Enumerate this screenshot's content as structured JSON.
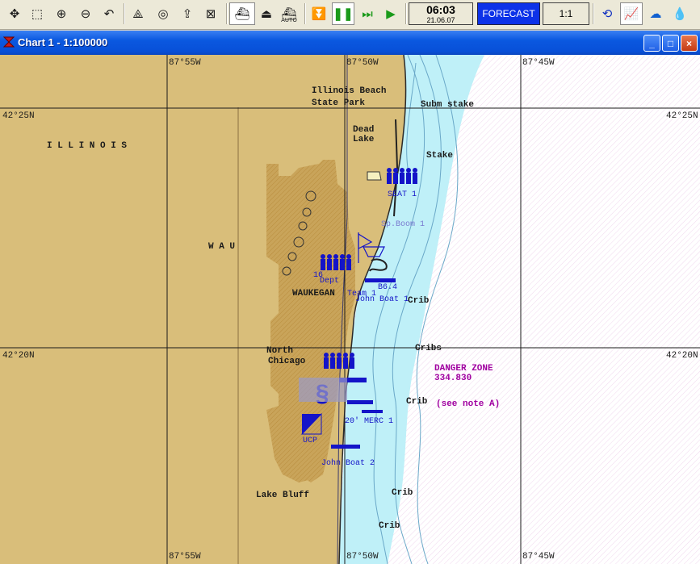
{
  "toolbar": {
    "buttons": [
      "pan-icon",
      "select-icon",
      "zoom-in-icon",
      "zoom-out-icon",
      "undo-icon",
      "route-icon",
      "target-icon",
      "export-icon",
      "import-icon",
      "ship-icon",
      "boat-icon",
      "auto-ship-icon",
      "stop-icon",
      "pause-icon",
      "fast-forward-icon",
      "play-icon",
      "weather-icon",
      "chart-icon",
      "wind-icon",
      "tide-icon"
    ],
    "auto_label": "AUTO",
    "clock_time": "06:03",
    "clock_date": "21.06.07",
    "forecast_label": "FORECAST",
    "scale_label": "1:1"
  },
  "window": {
    "title": "Chart 1 - 1:100000",
    "minimize": "_",
    "maximize": "□",
    "close": "×"
  },
  "map": {
    "longitudes": [
      "87°55W",
      "87°50W",
      "87°45W"
    ],
    "latitudes": [
      "42°25N",
      "42°20N"
    ],
    "places": {
      "illinois_beach": "Illinois Beach",
      "state_park": "State Park",
      "subm_stake": "Subm stake",
      "dead": "Dead",
      "lake": "Lake",
      "stake": "Stake",
      "illinois": "I L L I N O I S",
      "wau": "W A U",
      "waukegan": "WAUKEGAN",
      "crib_a": "Crib",
      "cribs": "Cribs",
      "north": "North",
      "chicago": "Chicago",
      "crib_b": "Crib",
      "danger_zone": "DANGER ZONE",
      "danger_freq": "334.830",
      "see_note": "(see note A)",
      "lake_bluff": "Lake Bluff",
      "crib_c": "Crib",
      "crib_d": "Crib"
    },
    "units": {
      "seat_1": "SEAT 1",
      "sp_boom": "Sp.Boom 1",
      "dept": "Dept",
      "team_1": "Team 1",
      "b6_4": "B6.4",
      "john_boat_1": "John Boat 1",
      "merc_1": "20' MERC 1",
      "ucp": "UCP",
      "john_boat_2": "John Boat 2",
      "num_16": "16"
    },
    "colors": {
      "land": "#d9be7a",
      "land_dark": "#c49a4a",
      "shallow_water": "#bff0f8",
      "deep_water": "#ffffff",
      "unit_blue": "#1414c8",
      "label_purple": "#a000a0"
    }
  }
}
